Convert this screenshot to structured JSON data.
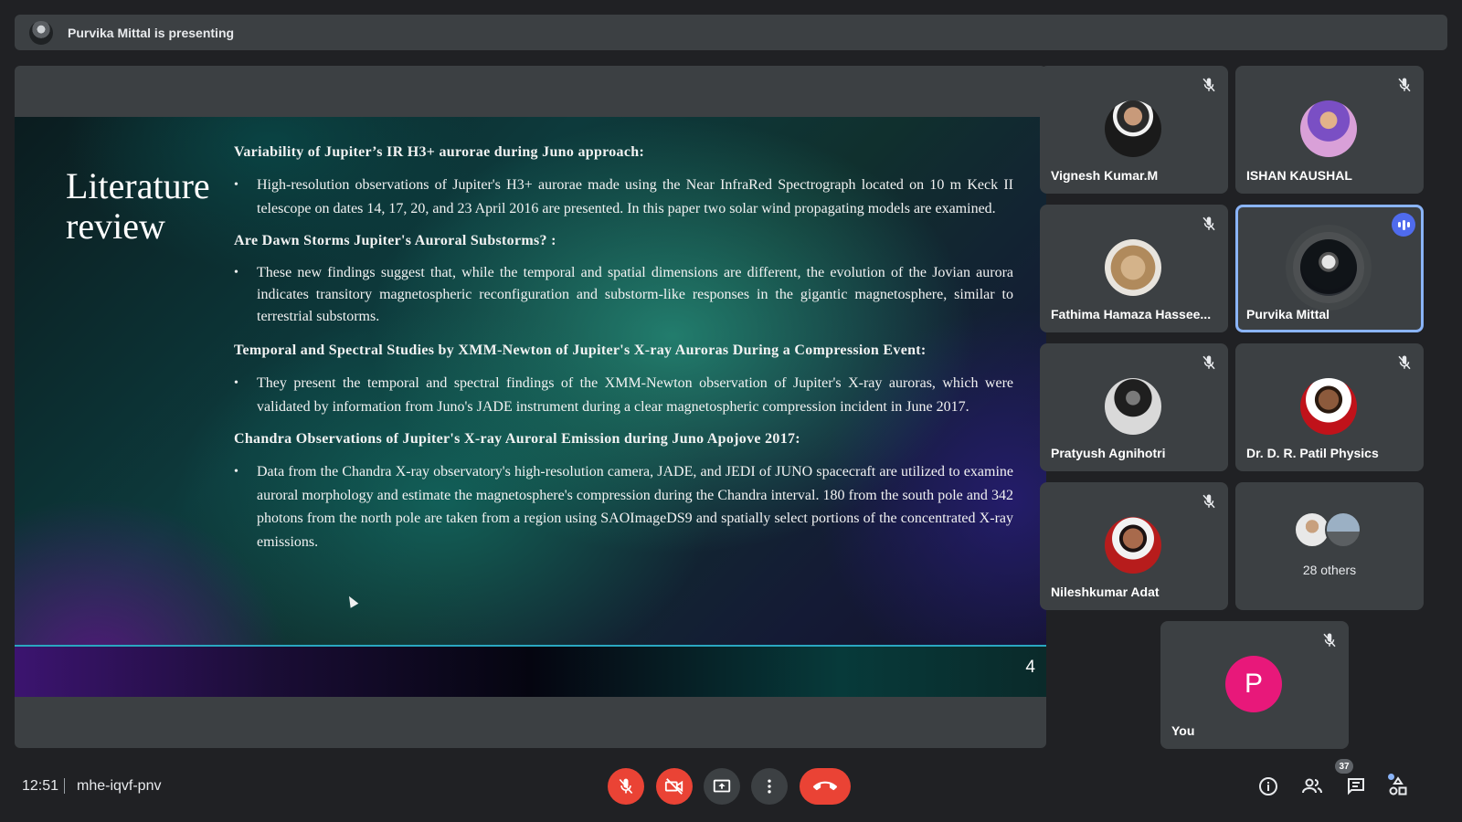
{
  "banner": {
    "text": "Purvika Mittal is presenting"
  },
  "slide": {
    "title_line1": "Literature",
    "title_line2": "review",
    "sections": [
      {
        "heading": "Variability of Jupiter’s IR H3+ aurorae during Juno approach:",
        "bullet": "High-resolution observations of Jupiter's H3+ aurorae made using the Near InfraRed Spectrograph located on 10 m Keck II telescope on dates 14, 17, 20, and 23 April 2016 are presented. In this paper two solar wind propagating models are examined."
      },
      {
        "heading": "Are Dawn Storms Jupiter's Auroral Substorms? :",
        "bullet": "These new findings suggest that, while the temporal and spatial dimensions are different, the evolution of the Jovian aurora indicates transitory magnetospheric reconfiguration and substorm-like responses in the gigantic magnetosphere, similar to terrestrial substorms."
      },
      {
        "heading": "Temporal and Spectral Studies by XMM-Newton of Jupiter's X-ray Auroras During a Compression Event:",
        "bullet": "They present the temporal and spectral findings of the XMM-Newton observation of Jupiter's X-ray auroras, which were validated by information from Juno's JADE instrument during a clear magnetospheric compression incident in June 2017."
      },
      {
        "heading": "Chandra Observations of Jupiter's X-ray Auroral Emission during Juno Apojove 2017:",
        "bullet": "Data from the Chandra X-ray observatory's high-resolution camera, JADE, and JEDI of JUNO spacecraft are utilized to examine auroral morphology and estimate the magnetosphere's compression during the Chandra interval. 180 from the south pole and 342 photons from the north pole are taken from a region using SAOImageDS9 and spatially select portions of the concentrated X-ray emissions."
      }
    ],
    "bullet_char": "•",
    "page_number": "4"
  },
  "participants": [
    {
      "name": "Vignesh Kumar.M",
      "muted": true
    },
    {
      "name": "ISHAN KAUSHAL",
      "muted": true
    },
    {
      "name": "Fathima Hamaza Hassee...",
      "muted": true
    },
    {
      "name": "Purvika Mittal",
      "muted": false,
      "speaking": true
    },
    {
      "name": "Pratyush Agnihotri",
      "muted": true
    },
    {
      "name": "Dr. D. R. Patil Physics",
      "muted": true
    },
    {
      "name": "Nileshkumar Adat",
      "muted": true
    }
  ],
  "others": {
    "label": "28 others"
  },
  "self": {
    "initial": "P",
    "name": "You",
    "avatar_color": "#e8187a"
  },
  "bottom": {
    "time": "12:51",
    "meeting_code": "mhe-iqvf-pnv",
    "people_count": "37",
    "controls": [
      "mic-off-icon",
      "camera-off-icon",
      "present-screen-icon",
      "more-options-icon",
      "end-call-icon"
    ],
    "right_icons": [
      "info-icon",
      "people-icon",
      "chat-icon",
      "activities-icon"
    ]
  },
  "colors": {
    "end_call": "#ea4335",
    "speaking": "#4f6bed",
    "active_border": "#8ab4f8"
  }
}
